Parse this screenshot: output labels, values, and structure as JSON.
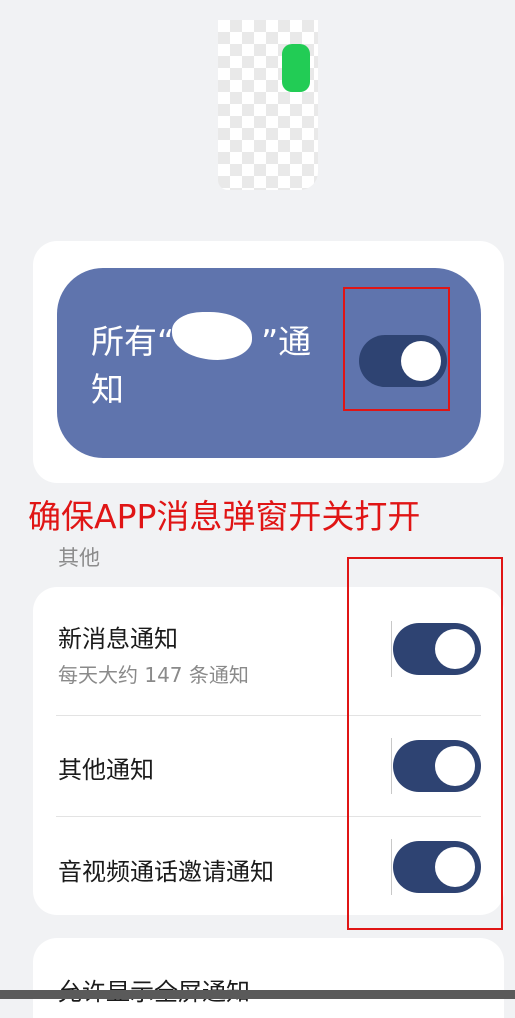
{
  "master": {
    "label": "所有“ 　　 ”通知",
    "enabled": true
  },
  "annotation": {
    "text": "确保APP消息弹窗开关打开"
  },
  "section": {
    "header": "其他"
  },
  "rows": [
    {
      "title": "新消息通知",
      "subtitle": "每天大约 147 条通知",
      "enabled": true
    },
    {
      "title": "其他通知",
      "enabled": true
    },
    {
      "title": "音视频通话邀请通知",
      "enabled": true
    }
  ],
  "bottom": {
    "title": "允许显示全屏通知"
  },
  "colors": {
    "panel": "#5f74ad",
    "switch_on": "#2e4372",
    "annotation": "#e01515"
  }
}
